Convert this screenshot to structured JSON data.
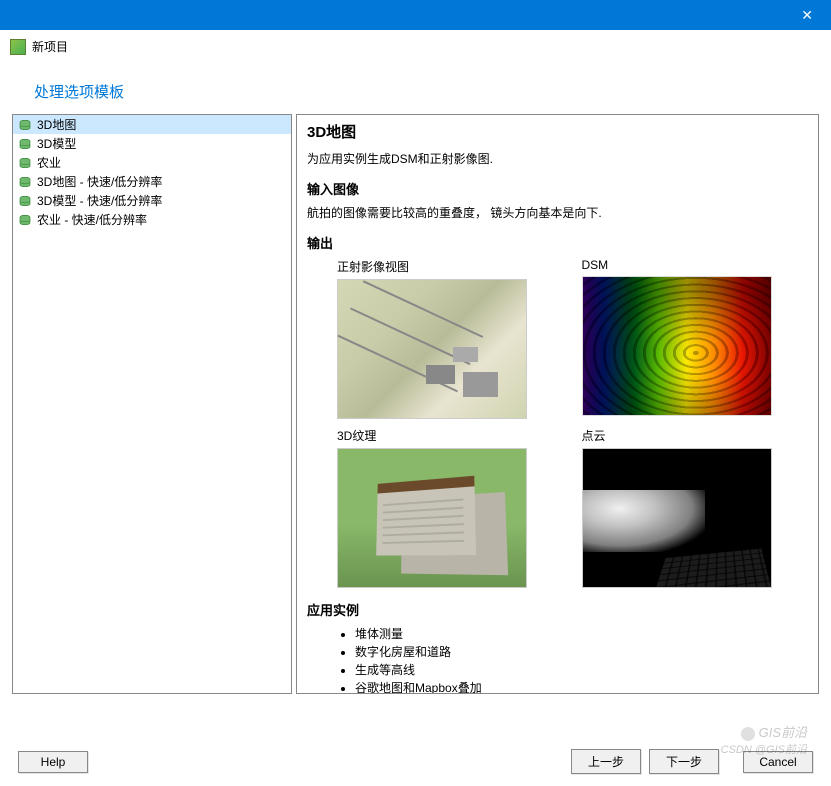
{
  "window": {
    "title": "新项目"
  },
  "section_title": "处理选项模板",
  "templates": [
    {
      "label": "3D地图",
      "selected": true
    },
    {
      "label": "3D模型",
      "selected": false
    },
    {
      "label": "农业",
      "selected": false
    },
    {
      "label": "3D地图 - 快速/低分辨率",
      "selected": false
    },
    {
      "label": "3D模型 - 快速/低分辨率",
      "selected": false
    },
    {
      "label": "农业 - 快速/低分辨率",
      "selected": false
    }
  ],
  "detail": {
    "title": "3D地图",
    "description": "为应用实例生成DSM和正射影像图.",
    "input_heading": "输入图像",
    "input_desc": "航拍的图像需要比较高的重叠度，  镜头方向基本是向下.",
    "output_heading": "输出",
    "outputs": [
      {
        "label": "正射影像视图",
        "kind": "ortho"
      },
      {
        "label": "DSM",
        "kind": "dsm"
      },
      {
        "label": "3D纹理",
        "kind": "texture"
      },
      {
        "label": "点云",
        "kind": "pointcloud"
      }
    ],
    "examples_heading": "应用实例",
    "examples": [
      "堆体测量",
      "数字化房屋和道路",
      "生成等高线",
      "谷歌地图和Mapbox叠加"
    ]
  },
  "buttons": {
    "help": "Help",
    "back": "上一步",
    "next": "下一步",
    "cancel": "Cancel"
  },
  "watermark": {
    "line1": "GIS前沿",
    "line2": "CSDN @GIS前沿"
  }
}
